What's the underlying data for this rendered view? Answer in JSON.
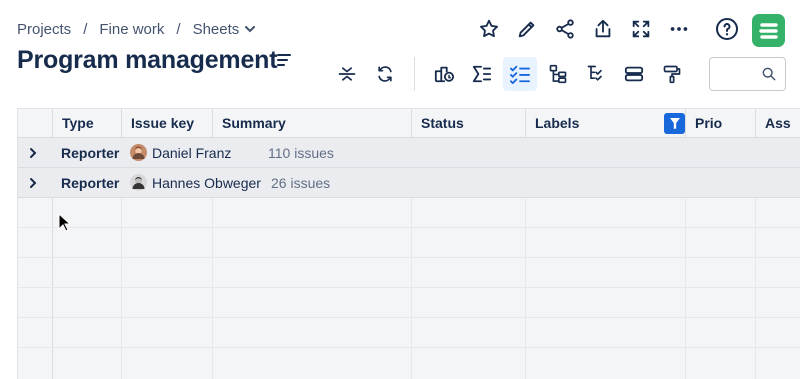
{
  "breadcrumb": {
    "items": [
      "Projects",
      "Fine work",
      "Sheets"
    ],
    "separator": "/"
  },
  "page_title": "Program management",
  "top_actions": [
    "star-icon",
    "edit-icon",
    "share-icon",
    "export-icon",
    "fullscreen-icon",
    "more-icon",
    "help-icon"
  ],
  "toolbar": [
    "collapse-icon",
    "refresh-icon",
    "add-view-icon",
    "sum-icon",
    "checklist-icon",
    "hierarchy-icon",
    "checked-tree-icon",
    "group-icon",
    "format-painter-icon"
  ],
  "search": {
    "placeholder": ""
  },
  "table": {
    "columns": [
      "Type",
      "Issue key",
      "Summary",
      "Status",
      "Labels",
      "Prio",
      "Ass"
    ],
    "groups": [
      {
        "label": "Reporter",
        "name": "Daniel Franz",
        "count": "110 issues"
      },
      {
        "label": "Reporter",
        "name": "Hannes Obweger",
        "count": "26 issues"
      }
    ]
  },
  "colors": {
    "accent": "#1868db",
    "logo": "#34b26a",
    "active_tool_bg": "#e9f2ff"
  }
}
